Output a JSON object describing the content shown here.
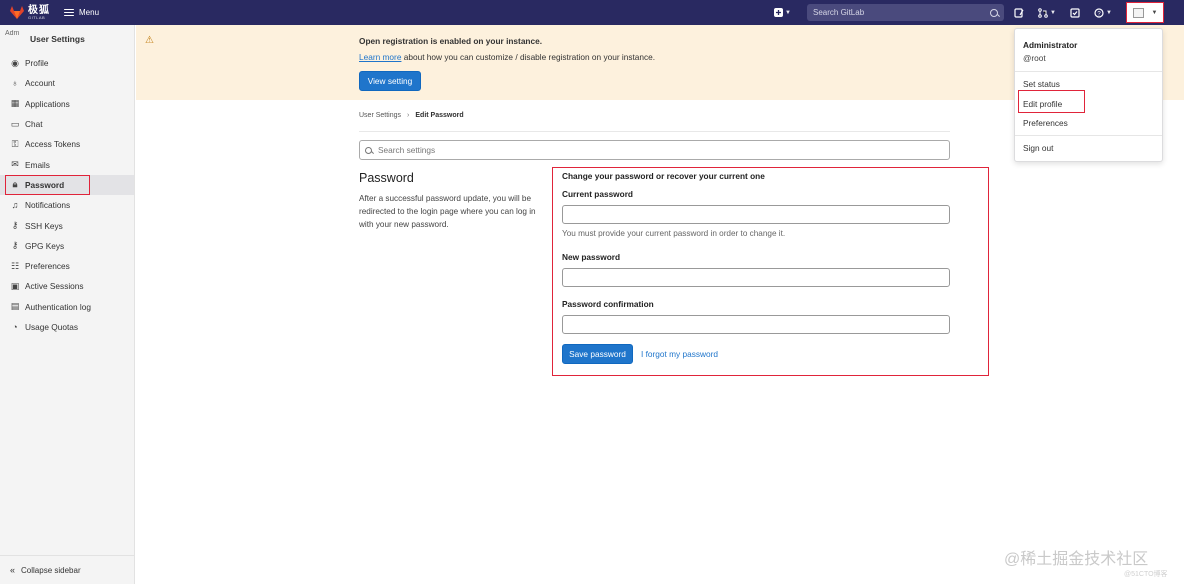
{
  "navbar": {
    "brand_text": "极狐",
    "brand_sub": "GITLAB",
    "menu_label": "Menu",
    "search_placeholder": "Search GitLab"
  },
  "sidebar": {
    "avatar_alt": "Adm",
    "title": "User Settings",
    "items": [
      {
        "label": "Profile",
        "icon": "profile-icon"
      },
      {
        "label": "Account",
        "icon": "account-icon"
      },
      {
        "label": "Applications",
        "icon": "applications-icon"
      },
      {
        "label": "Chat",
        "icon": "chat-icon"
      },
      {
        "label": "Access Tokens",
        "icon": "token-icon"
      },
      {
        "label": "Emails",
        "icon": "mail-icon"
      },
      {
        "label": "Password",
        "icon": "lock-icon",
        "active": true
      },
      {
        "label": "Notifications",
        "icon": "bell-icon"
      },
      {
        "label": "SSH Keys",
        "icon": "key-icon"
      },
      {
        "label": "GPG Keys",
        "icon": "key-icon"
      },
      {
        "label": "Preferences",
        "icon": "preferences-icon"
      },
      {
        "label": "Active Sessions",
        "icon": "monitor-icon"
      },
      {
        "label": "Authentication log",
        "icon": "log-icon"
      },
      {
        "label": "Usage Quotas",
        "icon": "quota-icon"
      }
    ],
    "collapse_label": "Collapse sidebar"
  },
  "banner": {
    "title": "Open registration is enabled on your instance.",
    "link_text": "Learn more",
    "text_rest": " about how you can customize / disable registration on your instance.",
    "button_label": "View setting"
  },
  "breadcrumb": {
    "parent": "User Settings",
    "current": "Edit Password"
  },
  "search_settings": {
    "placeholder": "Search settings"
  },
  "section": {
    "title": "Password",
    "description": "After a successful password update, you will be redirected to the login page where you can log in with your new password."
  },
  "form": {
    "heading": "Change your password or recover your current one",
    "current_label": "Current password",
    "current_help": "You must provide your current password in order to change it.",
    "new_label": "New password",
    "confirm_label": "Password confirmation",
    "save_label": "Save password",
    "forgot_label": "I forgot my password"
  },
  "dropdown": {
    "name": "Administrator",
    "username": "@root",
    "items": [
      "Set status",
      "Edit profile",
      "Preferences",
      "Sign out"
    ]
  },
  "watermark": "@稀土掘金技术社区",
  "watermark_small": "@51CTO博客",
  "colors": {
    "navbar": "#292961",
    "primary": "#1f75cb",
    "banner": "#fdf1dd",
    "highlight": "#e0243a"
  }
}
